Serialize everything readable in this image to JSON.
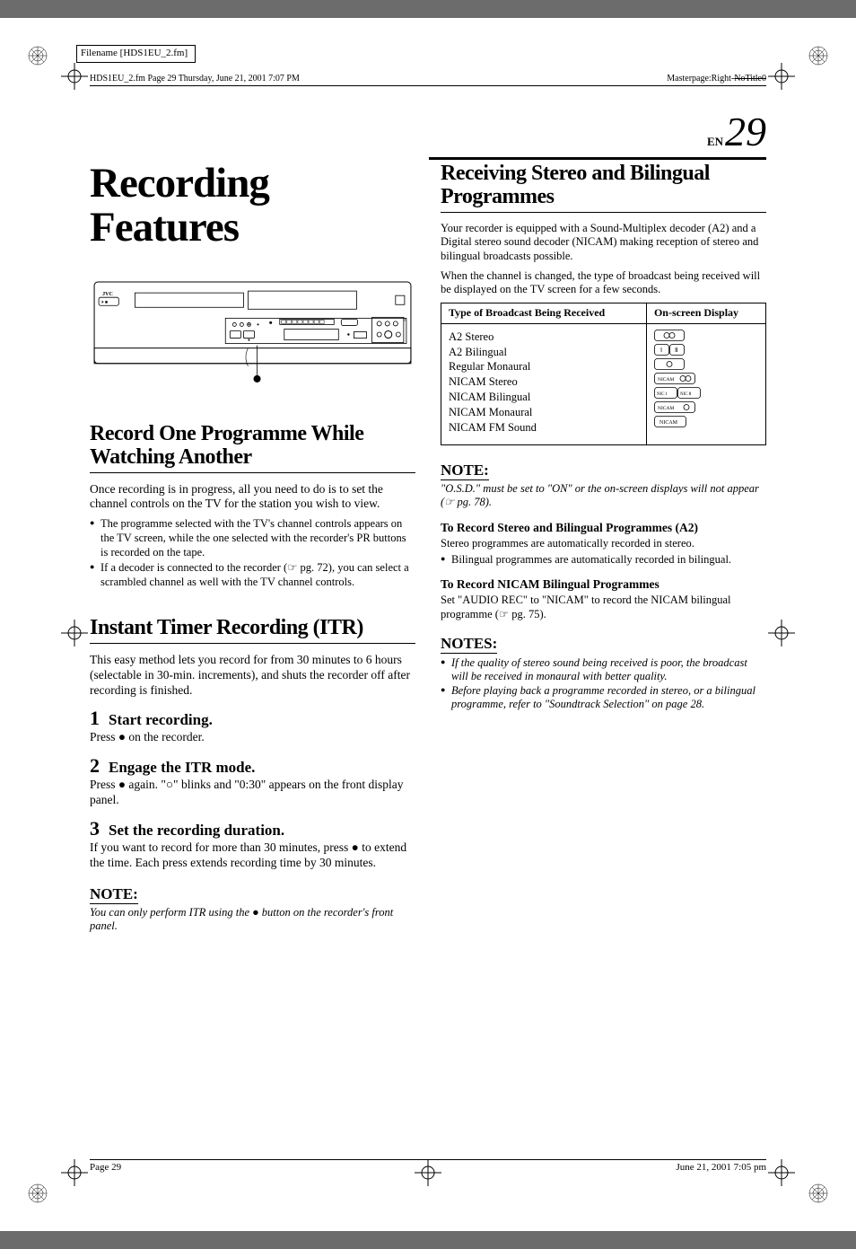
{
  "meta": {
    "filename_label": "Filename [HDS1EU_2.fm]",
    "header_left": "HDS1EU_2.fm  Page 29  Thursday, June 21, 2001  7:07 PM",
    "masterpage_prefix": "Masterpage:Right-",
    "masterpage_old": "NoTitle0",
    "en_label": "EN",
    "page_number": "29",
    "footer_left": "Page 29",
    "footer_right": "June 21, 2001 7:05 pm"
  },
  "left": {
    "title": "Recording Features",
    "section1_title": "Record One Programme While Watching Another",
    "section1_body": "Once recording is in progress, all you need to do is to set the channel controls on the TV for the station you wish to view.",
    "section1_bullets": [
      "The programme selected with the TV's channel controls appears on the TV screen, while the one selected with the recorder's PR buttons is recorded on the tape.",
      "If a decoder is connected to the recorder (☞ pg. 72), you can select a scrambled channel as well with the TV channel controls."
    ],
    "section2_title": "Instant Timer Recording (ITR)",
    "section2_body": "This easy method lets you record for from 30 minutes to 6 hours (selectable in 30-min. increments), and shuts the recorder off after recording is finished.",
    "steps": [
      {
        "num": "1",
        "title": "Start recording.",
        "body": "Press ● on the recorder."
      },
      {
        "num": "2",
        "title": "Engage the ITR mode.",
        "body": "Press ● again. \"○\" blinks and \"0:30\" appears on the front display panel."
      },
      {
        "num": "3",
        "title": "Set the recording duration.",
        "body": "If you want to record for more than 30 minutes, press ● to extend the time. Each press extends recording time by 30 minutes."
      }
    ],
    "note_head": "NOTE:",
    "note_body": "You can only perform ITR using the ● button on the recorder's front panel."
  },
  "right": {
    "section1_title": "Receiving Stereo and Bilingual Programmes",
    "section1_body1": "Your recorder is equipped with a Sound-Multiplex decoder (A2) and a Digital stereo sound decoder (NICAM) making reception of stereo and bilingual broadcasts possible.",
    "section1_body2": "When the channel is changed, the type of broadcast being received will be displayed on the TV screen for a few seconds.",
    "table_header_left": "Type of Broadcast Being Received",
    "table_header_right": "On-screen Display",
    "broadcast_types": [
      "A2 Stereo",
      "A2 Bilingual",
      "Regular Monaural",
      "NICAM Stereo",
      "NICAM Bilingual",
      "NICAM Monaural",
      "NICAM FM Sound"
    ],
    "note_head": "NOTE:",
    "note_body": "\"O.S.D.\" must be set to \"ON\" or the on-screen displays will not appear (☞ pg. 78).",
    "sub1_title": "To Record Stereo and Bilingual Programmes (A2)",
    "sub1_body": "Stereo programmes are automatically recorded in stereo.",
    "sub1_bullet": "Bilingual programmes are automatically recorded in bilingual.",
    "sub2_title": "To Record NICAM Bilingual Programmes",
    "sub2_body": "Set \"AUDIO REC\" to \"NICAM\" to record the NICAM bilingual programme (☞ pg. 75).",
    "notes_head": "NOTES:",
    "notes_bullets": [
      "If the quality of stereo sound being received is poor, the broadcast will be received in monaural with better quality.",
      "Before playing back a programme recorded in stereo, or a bilingual programme, refer to \"Soundtrack Selection\" on page 28."
    ]
  }
}
